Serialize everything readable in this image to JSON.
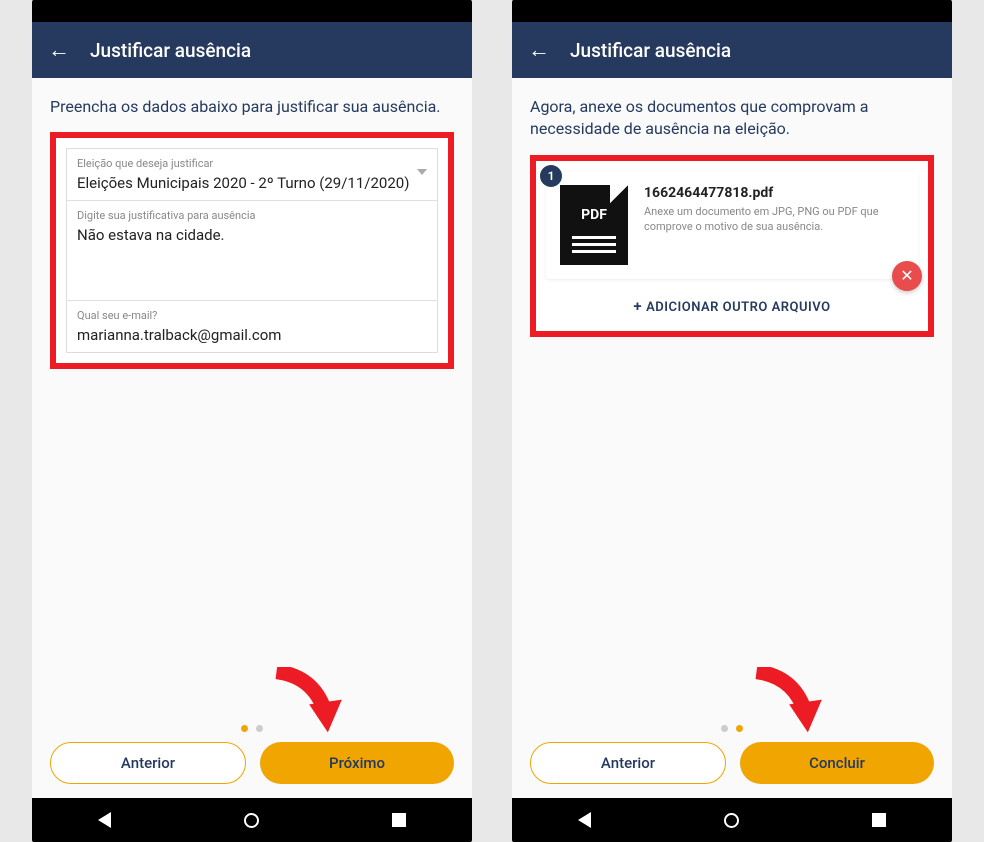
{
  "left": {
    "header": {
      "title": "Justificar ausência"
    },
    "instruction": "Preencha os dados abaixo para justificar sua ausência.",
    "field_election": {
      "label": "Eleição que deseja justificar",
      "value": "Eleições Municipais 2020 - 2º Turno (29/11/2020)"
    },
    "field_reason": {
      "label": "Digite sua justificativa para ausência",
      "value": "Não estava na cidade."
    },
    "field_email": {
      "label": "Qual seu e-mail?",
      "value": "marianna.tralback@gmail.com"
    },
    "buttons": {
      "prev": "Anterior",
      "next": "Próximo"
    },
    "pagination_active": 0
  },
  "right": {
    "header": {
      "title": "Justificar ausência"
    },
    "instruction": "Agora, anexe os documentos que comprovam a necessidade de ausência na eleição.",
    "attachment": {
      "index": "1",
      "icon_label": "PDF",
      "filename": "1662464477818.pdf",
      "desc": "Anexe um documento em JPG, PNG ou PDF que comprove o motivo de sua ausência."
    },
    "add_file": "ADICIONAR OUTRO ARQUIVO",
    "buttons": {
      "prev": "Anterior",
      "next": "Concluir"
    },
    "pagination_active": 1
  },
  "colors": {
    "header_bg": "#253a5e",
    "accent": "#f0a500",
    "highlight_border": "#ed1c24"
  }
}
